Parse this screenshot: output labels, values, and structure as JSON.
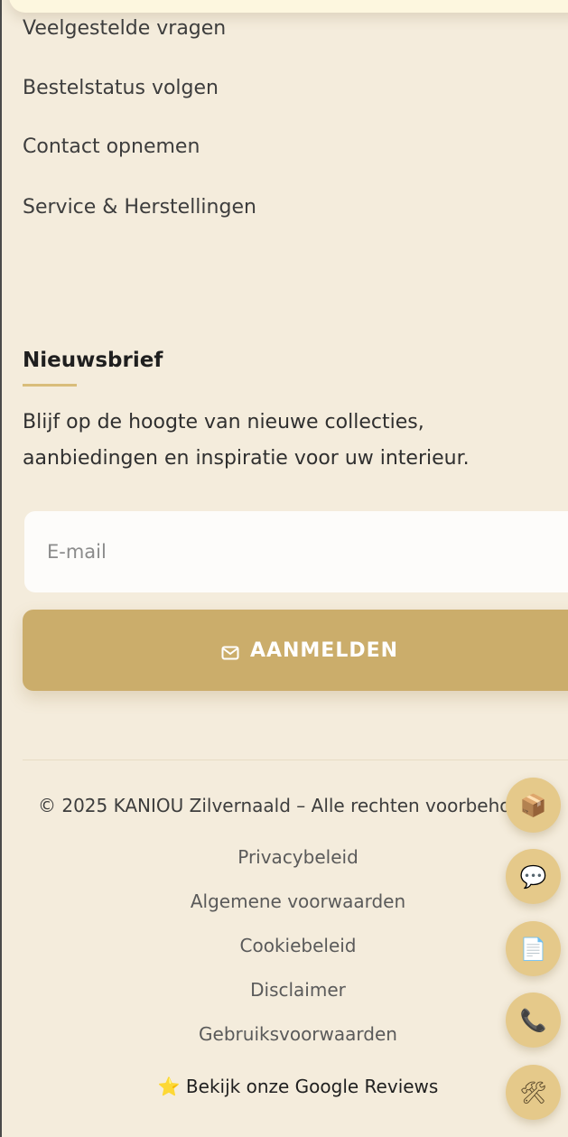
{
  "footer_links": [
    "Veelgestelde vragen",
    "Bestelstatus volgen",
    "Contact opnemen",
    "Service & Herstellingen"
  ],
  "newsletter": {
    "heading": "Nieuwsbrief",
    "description": "Blijf op de hoogte van nieuwe collecties, aanbiedingen en inspiratie voor uw interieur.",
    "email_placeholder": "E-mail",
    "email_value": "",
    "button_label": "AANMELDEN",
    "button_icon": "mail-icon"
  },
  "copyright": "© 2025 KANIOU Zilvernaald – Alle rechten voorbehouden",
  "legal_links": [
    "Privacybeleid",
    "Algemene voorwaarden",
    "Cookiebeleid",
    "Disclaimer",
    "Gebruiksvoorwaarden"
  ],
  "reviews_link": "⭐ Bekijk onze Google Reviews",
  "floating_actions": [
    {
      "icon": "package-icon",
      "glyph": "📦"
    },
    {
      "icon": "chat-icon",
      "glyph": "💬"
    },
    {
      "icon": "document-icon",
      "glyph": "📄"
    },
    {
      "icon": "phone-icon",
      "glyph": "📞"
    },
    {
      "icon": "tools-icon",
      "glyph": "🛠"
    }
  ],
  "colors": {
    "background": "#f4ecdc",
    "accent": "#cbad6b",
    "fab": "#e5c98a",
    "input_bg": "#fdfcfa"
  }
}
